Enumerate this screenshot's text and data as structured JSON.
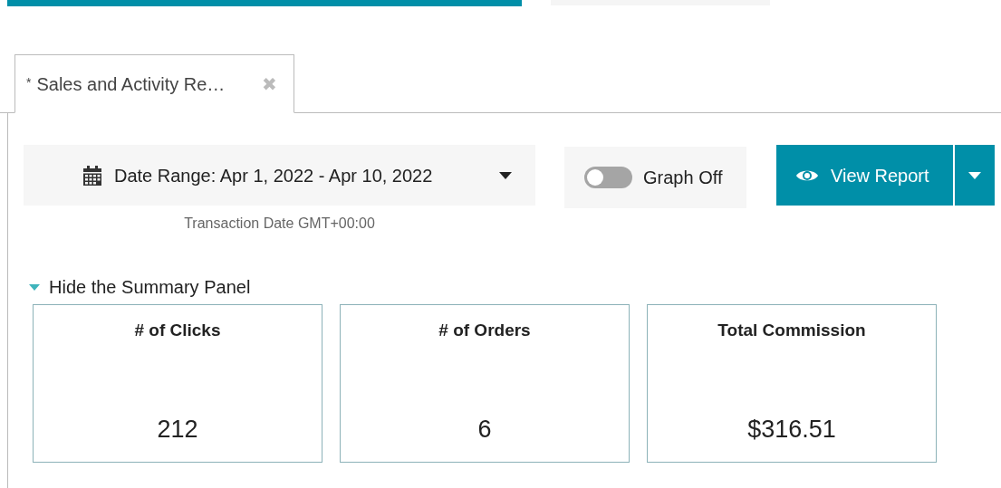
{
  "top_tabs": [
    {
      "selected": true
    },
    {
      "selected": false
    }
  ],
  "report_tab": {
    "modified_mark": "*",
    "title": "Sales and Activity Re…",
    "close": "✖",
    "selected": true
  },
  "date_range": {
    "label": "Date Range: Apr 1, 2022 - Apr 10, 2022",
    "note": "Transaction Date GMT+00:00"
  },
  "graph_toggle": {
    "label": "Graph Off",
    "on": false
  },
  "view_button": {
    "label": "View Report"
  },
  "summary": {
    "toggle_label": "Hide the Summary Panel",
    "expanded": true,
    "cards": [
      {
        "title": "# of Clicks",
        "value": "212"
      },
      {
        "title": "# of Orders",
        "value": "6"
      },
      {
        "title": "Total Commission",
        "value": "$316.51"
      }
    ]
  }
}
